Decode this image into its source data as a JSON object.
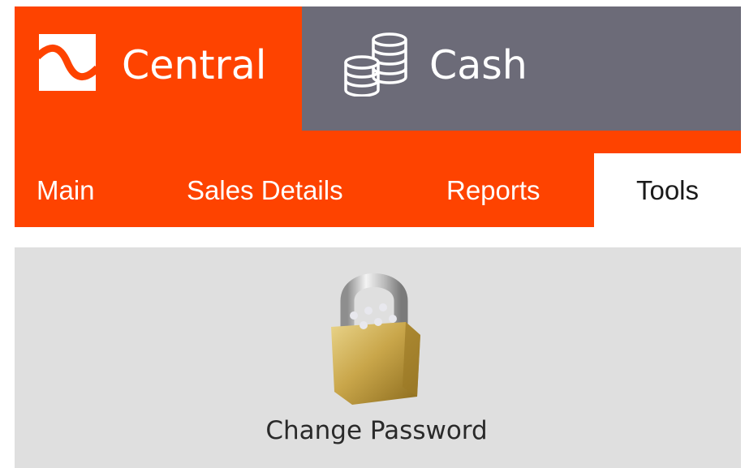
{
  "app_tabs": {
    "central": {
      "label": "Central",
      "icon": "central-logo-icon",
      "color": "#fe4300"
    },
    "cash": {
      "label": "Cash",
      "icon": "coins-stack-icon",
      "color": "#6c6b78"
    }
  },
  "nav": {
    "items": [
      {
        "label": "Main",
        "active": false
      },
      {
        "label": "Sales Details",
        "active": false
      },
      {
        "label": "Reports",
        "active": false
      },
      {
        "label": "Tools",
        "active": true
      }
    ],
    "bar_color": "#fe4300"
  },
  "tools": {
    "change_password": {
      "label": "Change Password",
      "icon": "padlock-icon"
    }
  },
  "colors": {
    "content_bg": "#dfdfdf",
    "active_tab_bg": "#ffffff"
  }
}
